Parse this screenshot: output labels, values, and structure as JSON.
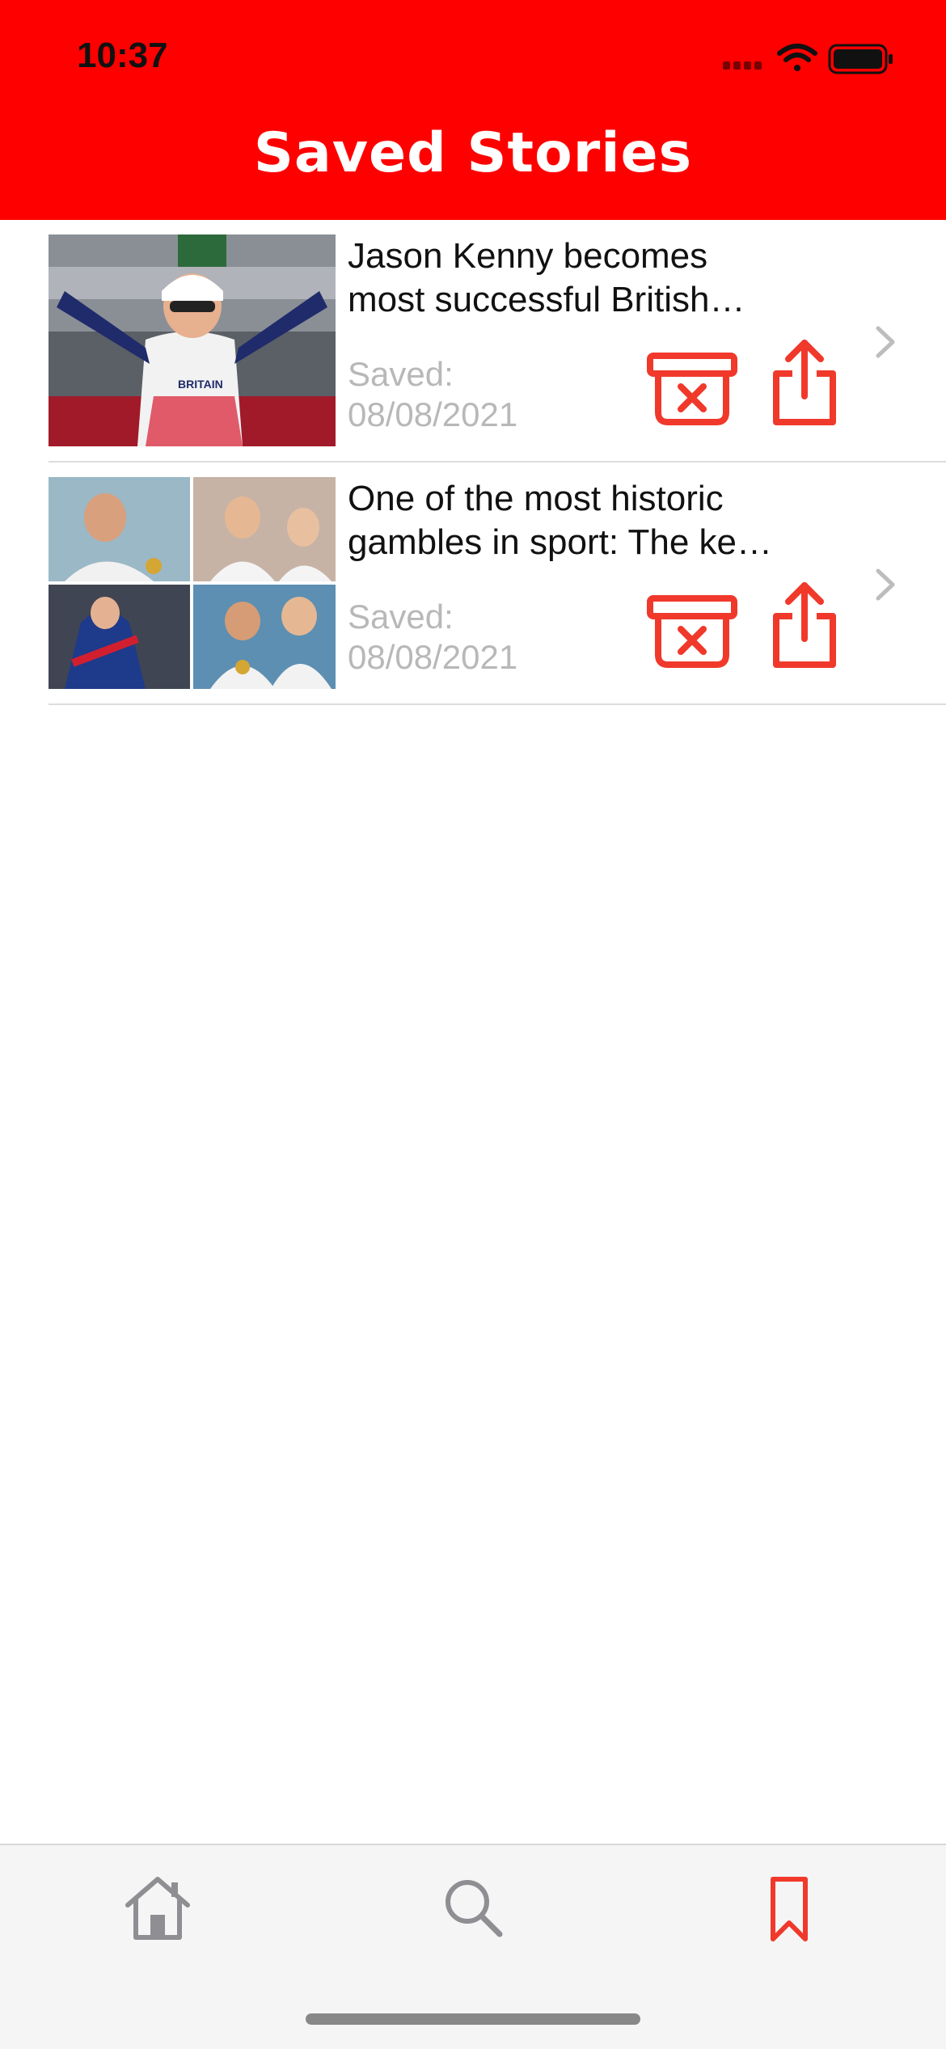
{
  "status_bar": {
    "time": "10:37",
    "icons": [
      "cellular-icon",
      "wifi-icon",
      "battery-icon"
    ]
  },
  "header": {
    "title": "Saved Stories",
    "background": "#ff0000"
  },
  "stories": [
    {
      "headline_line1": "Jason Kenny becomes",
      "headline_line2": "most successful British…",
      "saved_label": "Saved:",
      "saved_date": "08/08/2021",
      "thumbnail": "cyclist-photo"
    },
    {
      "headline_line1": "One of the most historic",
      "headline_line2": "gambles in sport: The ke…",
      "saved_label": "Saved:",
      "saved_date": "08/08/2021",
      "thumbnail": "medalists-collage"
    }
  ],
  "tabs": [
    {
      "name": "home",
      "icon": "home-icon",
      "active": false
    },
    {
      "name": "search",
      "icon": "search-icon",
      "active": false
    },
    {
      "name": "saved",
      "icon": "bookmark-icon",
      "active": true
    }
  ],
  "colors": {
    "accent": "#ff0000",
    "action": "#f0392b",
    "muted_text": "#b8b8b8",
    "inactive_tab": "#8e8e93"
  }
}
